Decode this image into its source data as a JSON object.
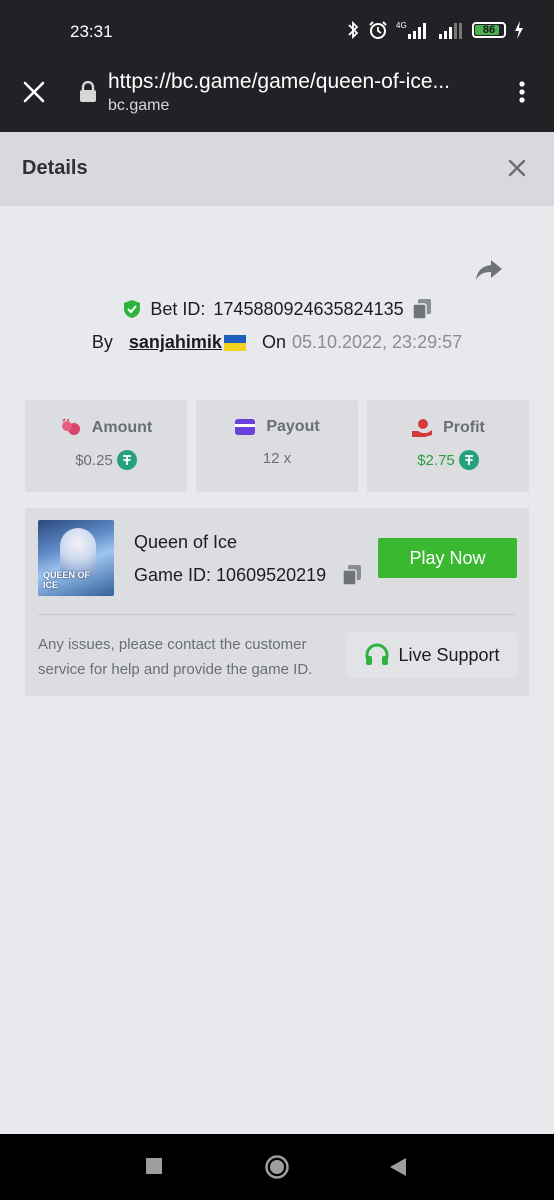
{
  "status_bar": {
    "time": "23:31",
    "network": "4G",
    "battery": "86",
    "battery_level": 0.86
  },
  "browser": {
    "url": "https://bc.game/game/queen-of-ice...",
    "domain": "bc.game"
  },
  "details": {
    "title": "Details"
  },
  "bet": {
    "id_label": "Bet ID:",
    "id_value": "1745880924635824135",
    "by_label": "By",
    "username": "sanjahimik",
    "on_label": "On",
    "date": "05.10.2022, 23:29:57"
  },
  "stats": {
    "amount": {
      "label": "Amount",
      "value": "$0.25"
    },
    "payout": {
      "label": "Payout",
      "value": "12 x"
    },
    "profit": {
      "label": "Profit",
      "value": "$2.75"
    }
  },
  "game": {
    "name": "Queen of Ice",
    "id_label": "Game ID:",
    "id_value": "10609520219",
    "thumb_text_1": "QUEEN OF",
    "thumb_text_2": "ICE",
    "play_label": "Play Now",
    "issues_text": "Any issues, please contact the customer service for help and provide the game ID.",
    "support_label": "Live Support"
  },
  "colors": {
    "accent_green": "#3ab830",
    "profit_green": "#2e9e3f",
    "tether_green": "#26a17b",
    "dark_bar": "#212226"
  },
  "icons": {
    "verified": "shield-check-icon",
    "copy": "copy-icon",
    "share": "share-icon",
    "amount": "coins-icon",
    "payout": "card-icon",
    "profit": "hand-coin-icon",
    "support": "headset-icon"
  }
}
